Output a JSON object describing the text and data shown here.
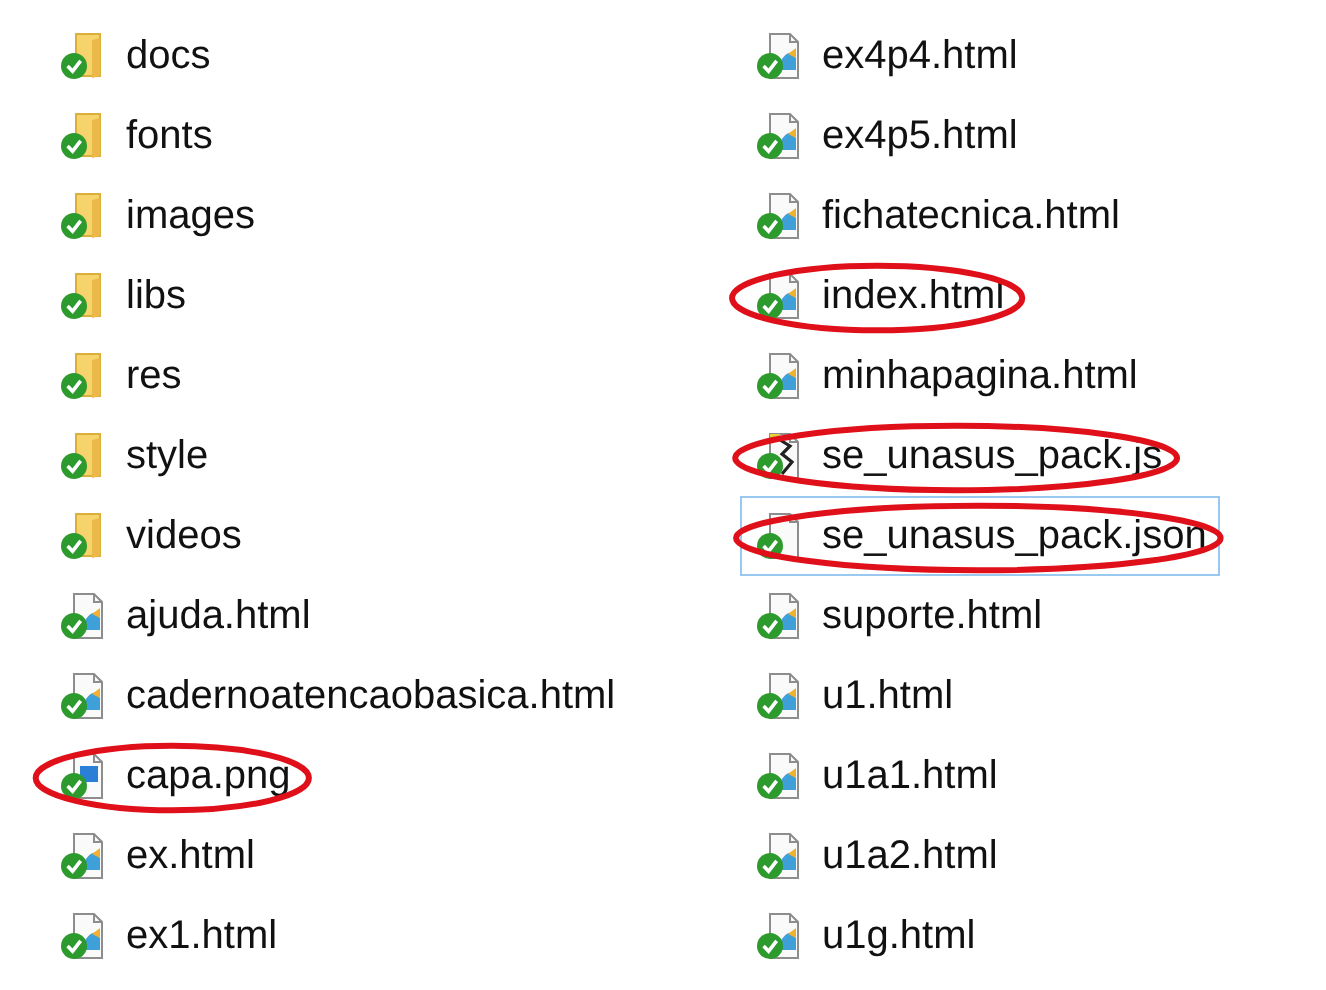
{
  "columns": [
    [
      {
        "name": "docs",
        "kind": "folder",
        "highlighted": false,
        "focused": false
      },
      {
        "name": "fonts",
        "kind": "folder",
        "highlighted": false,
        "focused": false
      },
      {
        "name": "images",
        "kind": "folder",
        "highlighted": false,
        "focused": false
      },
      {
        "name": "libs",
        "kind": "folder",
        "highlighted": false,
        "focused": false
      },
      {
        "name": "res",
        "kind": "folder",
        "highlighted": false,
        "focused": false
      },
      {
        "name": "style",
        "kind": "folder",
        "highlighted": false,
        "focused": false
      },
      {
        "name": "videos",
        "kind": "folder",
        "highlighted": false,
        "focused": false
      },
      {
        "name": "ajuda.html",
        "kind": "html",
        "highlighted": false,
        "focused": false
      },
      {
        "name": "cadernoatencaobasica.html",
        "kind": "html",
        "highlighted": false,
        "focused": false
      },
      {
        "name": "capa.png",
        "kind": "image",
        "highlighted": true,
        "focused": false
      },
      {
        "name": "ex.html",
        "kind": "html",
        "highlighted": false,
        "focused": false
      },
      {
        "name": "ex1.html",
        "kind": "html",
        "highlighted": false,
        "focused": false
      }
    ],
    [
      {
        "name": "ex4p4.html",
        "kind": "html",
        "highlighted": false,
        "focused": false
      },
      {
        "name": "ex4p5.html",
        "kind": "html",
        "highlighted": false,
        "focused": false
      },
      {
        "name": "fichatecnica.html",
        "kind": "html",
        "highlighted": false,
        "focused": false
      },
      {
        "name": "index.html",
        "kind": "html",
        "highlighted": true,
        "focused": false
      },
      {
        "name": "minhapagina.html",
        "kind": "html",
        "highlighted": false,
        "focused": false
      },
      {
        "name": "se_unasus_pack.js",
        "kind": "script",
        "highlighted": true,
        "focused": false
      },
      {
        "name": "se_unasus_pack.json",
        "kind": "file",
        "highlighted": true,
        "focused": true
      },
      {
        "name": "suporte.html",
        "kind": "html",
        "highlighted": false,
        "focused": false
      },
      {
        "name": "u1.html",
        "kind": "html",
        "highlighted": false,
        "focused": false
      },
      {
        "name": "u1a1.html",
        "kind": "html",
        "highlighted": false,
        "focused": false
      },
      {
        "name": "u1a2.html",
        "kind": "html",
        "highlighted": false,
        "focused": false
      },
      {
        "name": "u1g.html",
        "kind": "html",
        "highlighted": false,
        "focused": false
      }
    ]
  ]
}
